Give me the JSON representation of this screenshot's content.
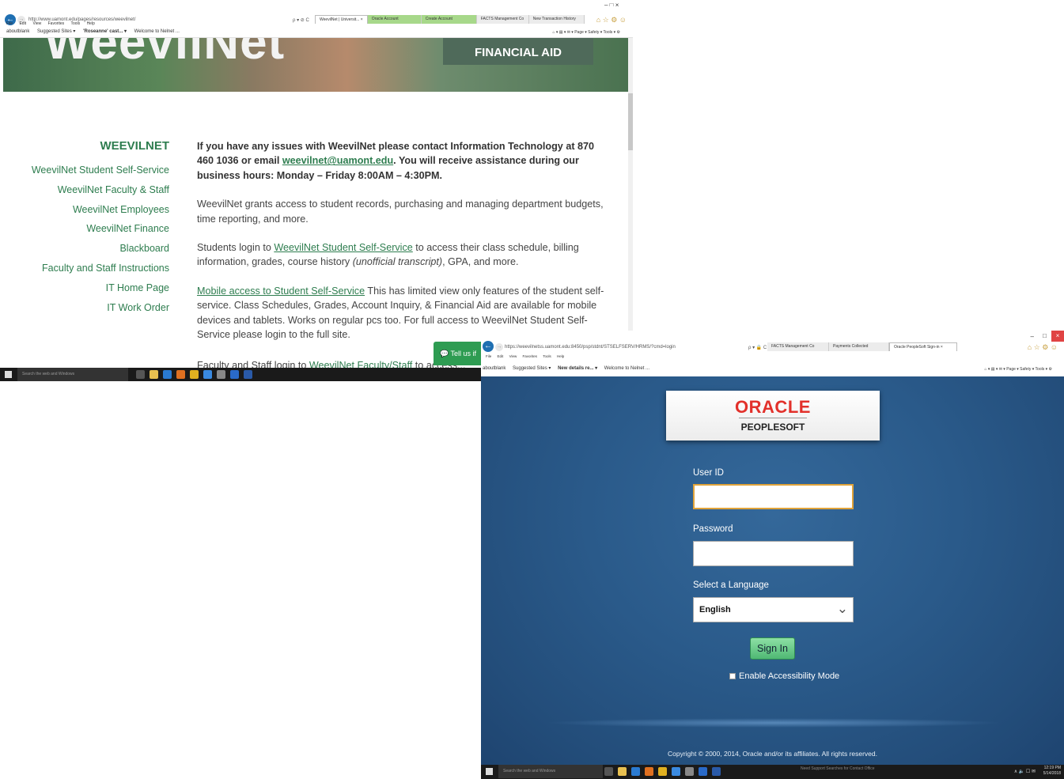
{
  "window1": {
    "address": "http://www.uamont.edu/pages/resources/weevilnet/",
    "nav_icons": "ρ ▾ ⊘ C",
    "tabs": [
      {
        "label": "WeevilNet | Universit... ×",
        "style": "active"
      },
      {
        "label": "Oracle Account",
        "style": "green"
      },
      {
        "label": "Create Account",
        "style": "green"
      },
      {
        "label": "FACTS Management Co",
        "style": "plain"
      },
      {
        "label": "New Transaction History",
        "style": "plain"
      }
    ],
    "window_controls": "–  □  ×",
    "menu": [
      "File",
      "Edit",
      "View",
      "Favorites",
      "Tools",
      "Help"
    ],
    "favorites": [
      "aboutblank",
      "Suggested Sites ▾",
      "'Roseanne' cast... ▾",
      "Welcome to Nelnet ..."
    ],
    "toolbar": "⌂ ▾ ▤ ▾ ✉ ▾ Page ▾  Safety ▾  Tools ▾ ⚙",
    "hero_big_text": "WeevilNet",
    "hero_badge": "FINANCIAL AID",
    "sidebar": {
      "heading": "WEEVILNET",
      "links": [
        "WeevilNet Student Self-Service",
        "WeevilNet Faculty & Staff",
        "WeevilNet Employees",
        "WeevilNet Finance",
        "Blackboard",
        "Faculty and Staff Instructions",
        "IT Home Page",
        "IT Work Order"
      ]
    },
    "content": {
      "p1_a": "If you have any issues with WeevilNet please contact Information Technology at 870 460 1036 or email ",
      "p1_link": "weevilnet@uamont.edu",
      "p1_b": ". You will receive assistance during our business hours: Monday – Friday 8:00AM – 4:30PM.",
      "p2": "WeevilNet grants access to student records, purchasing and managing department budgets, time reporting, and more.",
      "p3_a": "Students login to ",
      "p3_link": "WeevilNet Student Self-Service",
      "p3_b": " to access their class schedule, billing information, grades, course history ",
      "p3_italic": "(unofficial transcript)",
      "p3_c": ", GPA, and more.",
      "p4_link": "Mobile access to Student Self-Service",
      "p4_b": "   This has limited view only features of the student self-service.  Class Schedules, Grades, Account Inquiry, & Financial Aid are available for mobile devices and tablets.   Works on regular pcs too.   For full access to WeevilNet Student Self-Service please login to the full site.",
      "p5_a": "Faculty and Staff login to ",
      "p5_link": "WeevilNet Faculty/Staff",
      "p5_b": " to access..."
    },
    "tell_us": "💬  Tell us if",
    "taskbar_search": "Search the web and Windows"
  },
  "window2": {
    "address": "https://weevilnetss.uamont.edu:8450/psp/stdnt/STSELFSERV/HRMS/?cmd=login",
    "nav_icons": "ρ ▾ 🔒 C",
    "tabs": [
      {
        "label": "FACTS Management Co",
        "style": "plain"
      },
      {
        "label": "Payments Collected",
        "style": "plain"
      },
      {
        "label": "Oracle PeopleSoft Sign-in ×",
        "style": "active"
      }
    ],
    "menu": [
      "File",
      "Edit",
      "View",
      "Favorites",
      "Tools",
      "Help"
    ],
    "favorites": [
      "aboutblank",
      "Suggested Sites ▾",
      "New details re... ▾",
      "Welcome to Nelnet ..."
    ],
    "toolbar": "⌂ ▾ ▤ ▾ ✉ ▾ Page ▾  Safety ▾  Tools ▾ ⚙",
    "logo_brand": "ORACLE",
    "logo_product": "PEOPLESOFT",
    "user_id_label": "User ID",
    "user_id_value": "",
    "password_label": "Password",
    "password_value": "",
    "language_label": "Select a Language",
    "language_value": "English",
    "sign_in": "Sign In",
    "accessibility": "Enable Accessibility Mode",
    "copyright": "Copyright © 2000, 2014, Oracle and/or its affiliates. All rights reserved.",
    "taskbar_search": "Search the web and Windows",
    "taskbar_notice": "Need Support Searches\nfor Contact Office",
    "clock_time": "12:19 PM",
    "clock_date": "5/14/2018",
    "tray": "∧ 🔈 ☐ ✉"
  },
  "colors": {
    "accent_green": "#2e7d4f",
    "oracle_red": "#e2312b",
    "login_blue": "#2a5a8a",
    "signin_green": "#4fb874"
  }
}
